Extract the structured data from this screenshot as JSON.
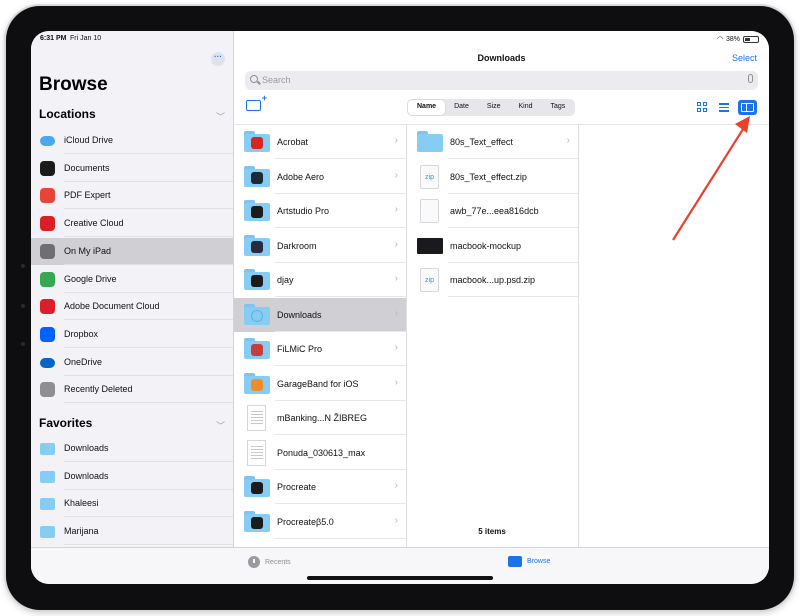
{
  "status": {
    "time": "6:31 PM",
    "date": "Fri Jan 10",
    "battery": "38%"
  },
  "sidebar": {
    "more_label": "···",
    "title": "Browse",
    "locations_title": "Locations",
    "locations": [
      {
        "label": "iCloud Drive",
        "icon": "icloud-drive-icon",
        "color": "#4aa8f0"
      },
      {
        "label": "Documents",
        "icon": "documents-app-icon",
        "color": "#1b1b1b"
      },
      {
        "label": "PDF Expert",
        "icon": "pdf-expert-icon",
        "color": "#e8443a"
      },
      {
        "label": "Creative Cloud",
        "icon": "creative-cloud-icon",
        "color": "#da1f26"
      },
      {
        "label": "On My iPad",
        "icon": "ipad-icon",
        "color": "#6e6e73"
      },
      {
        "label": "Google Drive",
        "icon": "google-drive-icon",
        "color": "#34a853"
      },
      {
        "label": "Adobe Document Cloud",
        "icon": "adobe-document-cloud-icon",
        "color": "#da1f26"
      },
      {
        "label": "Dropbox",
        "icon": "dropbox-icon",
        "color": "#0061fe"
      },
      {
        "label": "OneDrive",
        "icon": "onedrive-icon",
        "color": "#0a64c8"
      },
      {
        "label": "Recently Deleted",
        "icon": "trash-icon",
        "color": "#8e8e93"
      }
    ],
    "favorites_title": "Favorites",
    "favorites": [
      {
        "label": "Downloads"
      },
      {
        "label": "Downloads"
      },
      {
        "label": "Khaleesi"
      },
      {
        "label": "Marijana"
      }
    ]
  },
  "header": {
    "title": "Downloads",
    "select_label": "Select"
  },
  "search": {
    "placeholder": "Search"
  },
  "sort": {
    "options": [
      "Name",
      "Date",
      "Size",
      "Kind",
      "Tags"
    ],
    "active": "Name"
  },
  "column1": [
    {
      "name": "Acrobat",
      "badge": "#d8251f"
    },
    {
      "name": "Adobe Aero",
      "badge": "#1e2a3a"
    },
    {
      "name": "Artstudio Pro",
      "badge": "#1b1b1b"
    },
    {
      "name": "Darkroom",
      "badge": "#2a2a3e"
    },
    {
      "name": "djay",
      "badge": "#1b1b1b"
    },
    {
      "name": "Downloads",
      "badge": ""
    },
    {
      "name": "FiLMiC Pro",
      "badge": "#c63d3d"
    },
    {
      "name": "GarageBand for iOS",
      "badge": "#f08c2a"
    },
    {
      "name": "mBanking...N ŽIBREG",
      "badge": ""
    },
    {
      "name": "Ponuda_030613_max",
      "badge": ""
    },
    {
      "name": "Procreate",
      "badge": "#1b1b1b"
    },
    {
      "name": "Procreateβ5.0",
      "badge": "#1b1b1b"
    }
  ],
  "column2": [
    {
      "name": "80s_Text_effect"
    },
    {
      "name": "80s_Text_effect.zip",
      "ext": "zip"
    },
    {
      "name": "awb_77e...eea816dcb"
    },
    {
      "name": "macbook-mockup"
    },
    {
      "name": "macbook...up.psd.zip",
      "ext": "zip"
    }
  ],
  "items_count": "5 items",
  "tabbar": {
    "recents": "Recents",
    "browse": "Browse"
  },
  "accent": "#1a73e8",
  "annotation_color": "#e8412c"
}
